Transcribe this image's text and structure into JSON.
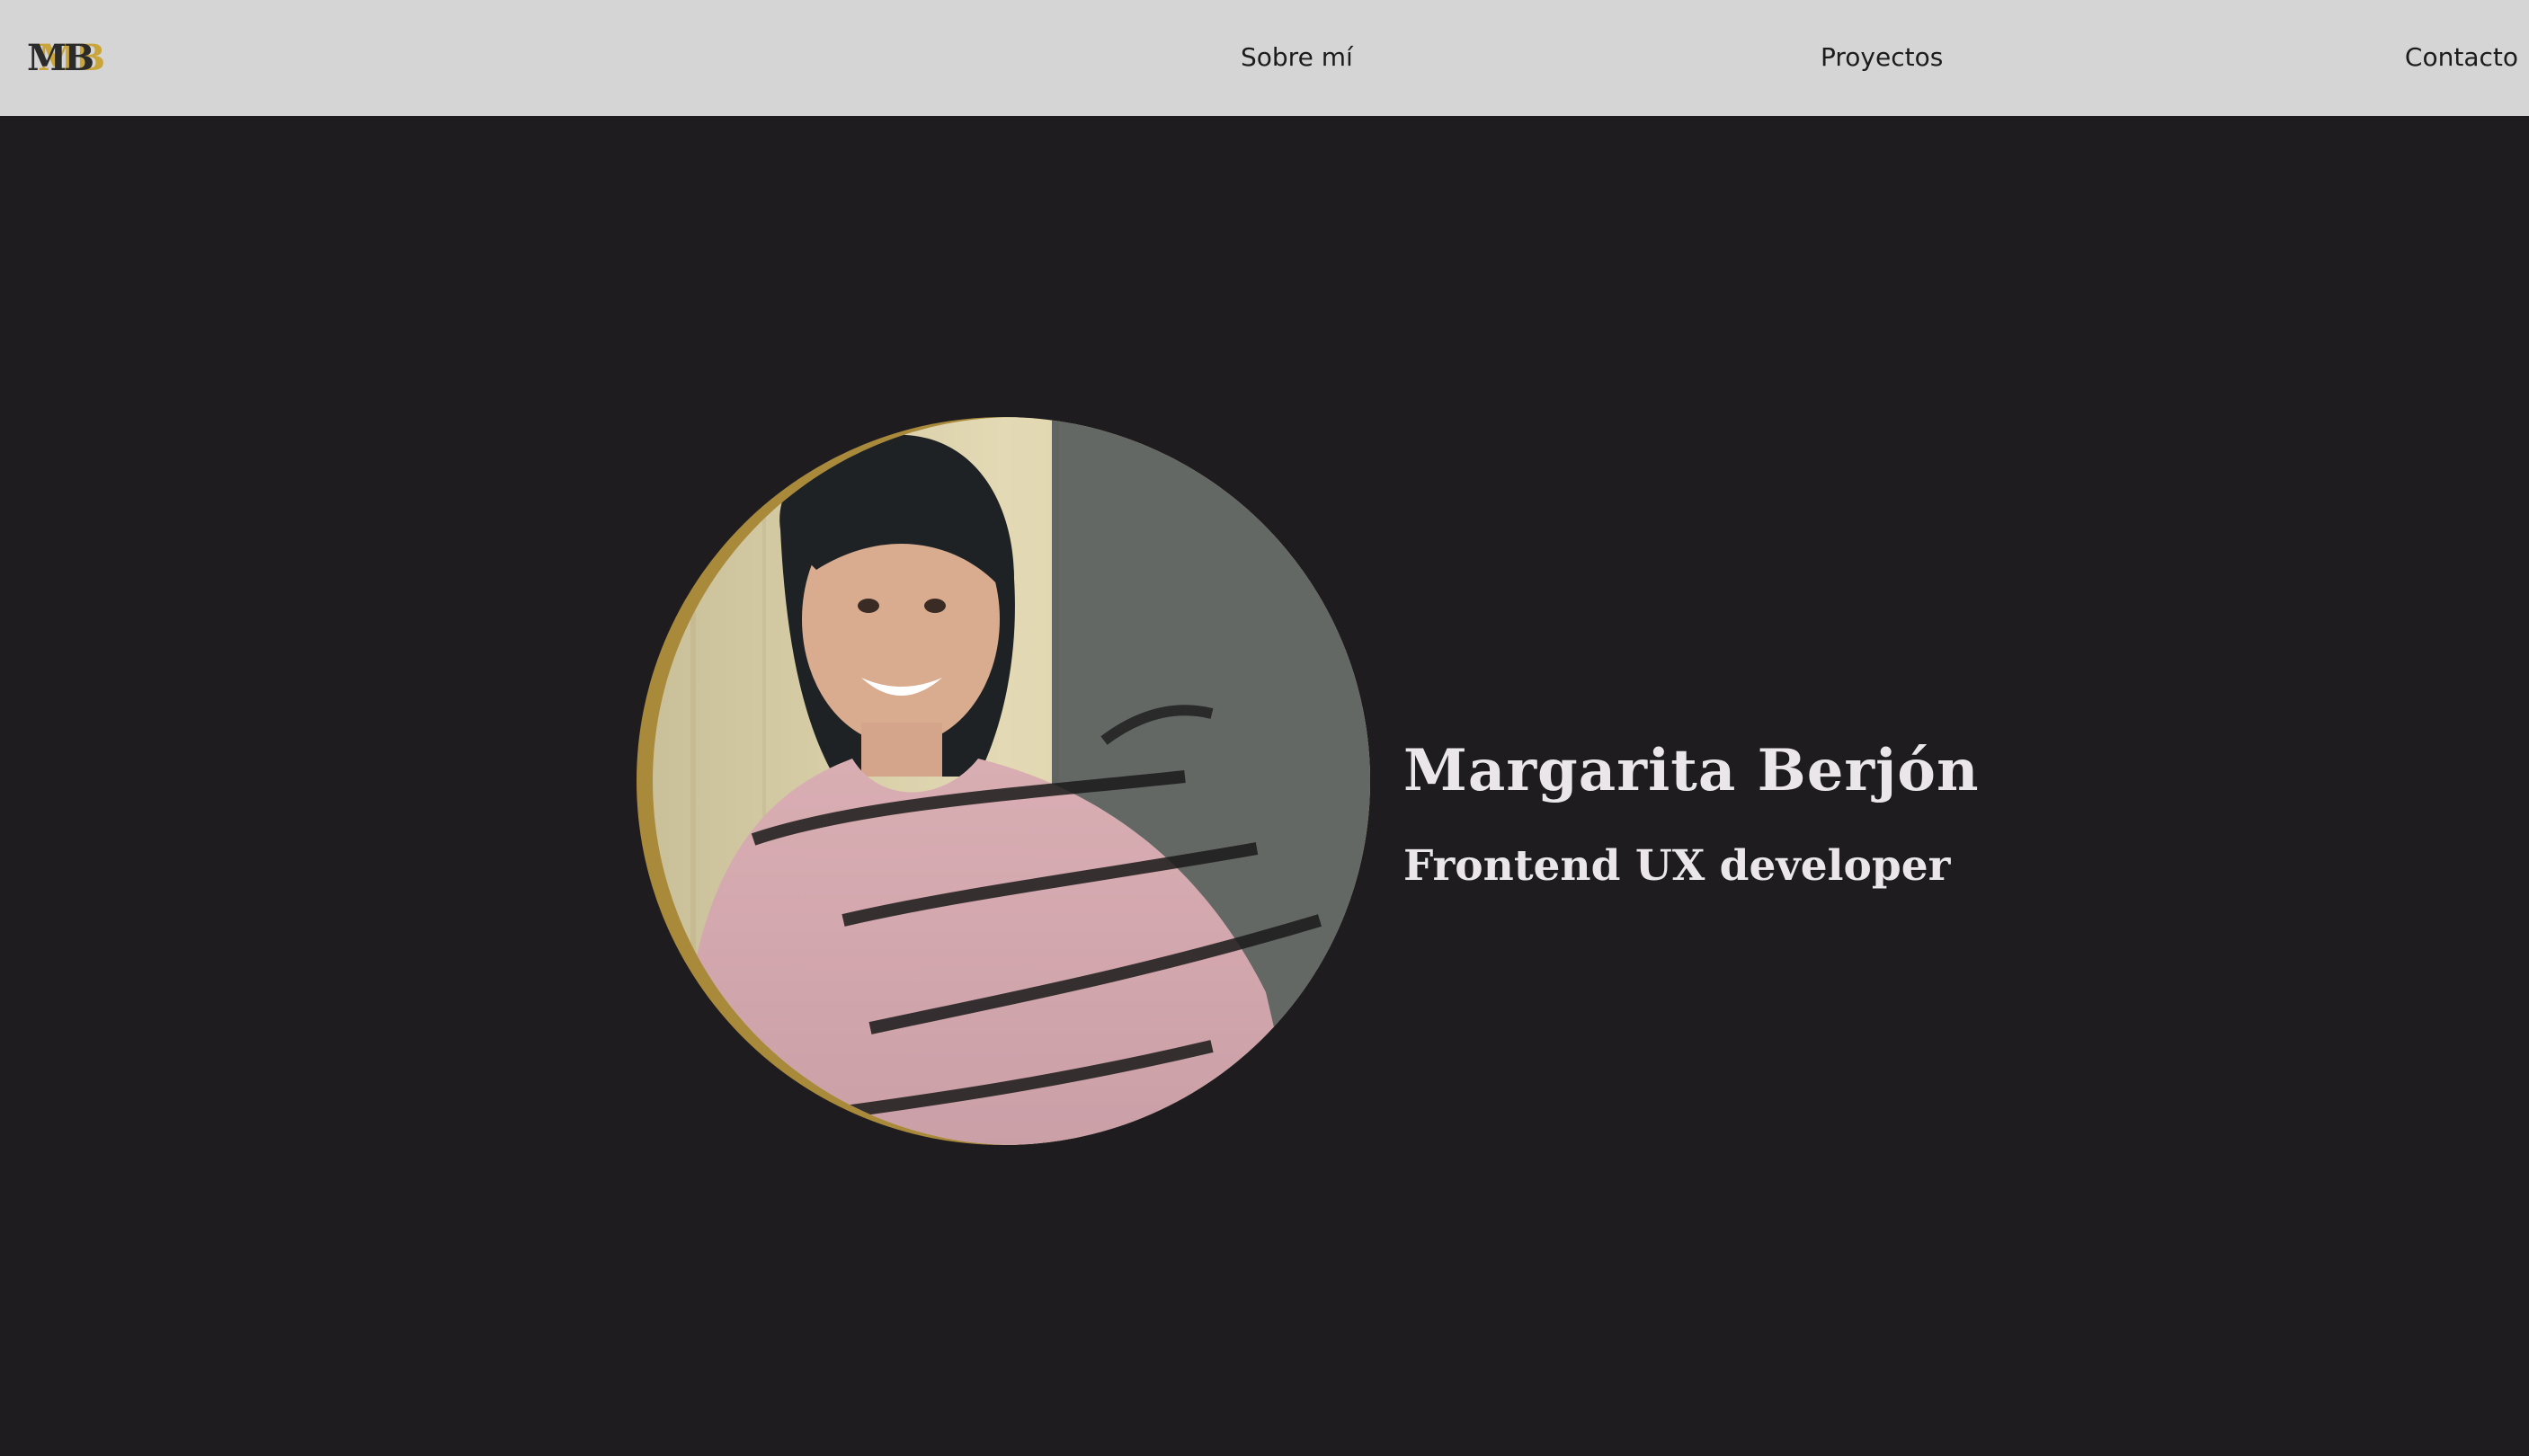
{
  "header": {
    "logo_text": "MB",
    "nav_items": [
      {
        "label": "Sobre mí"
      },
      {
        "label": "Proyectos"
      },
      {
        "label": "Contacto"
      }
    ]
  },
  "hero": {
    "name": "Margarita Berjón",
    "role": "Frontend UX developer",
    "photo_icon": "portrait-photo"
  },
  "colors": {
    "header_bg": "#d5d5d5",
    "page_bg": "#1e1c1f",
    "accent_gold": "#a9893a",
    "text_light": "#eae6ea",
    "nav_text": "#1c1c1c"
  }
}
